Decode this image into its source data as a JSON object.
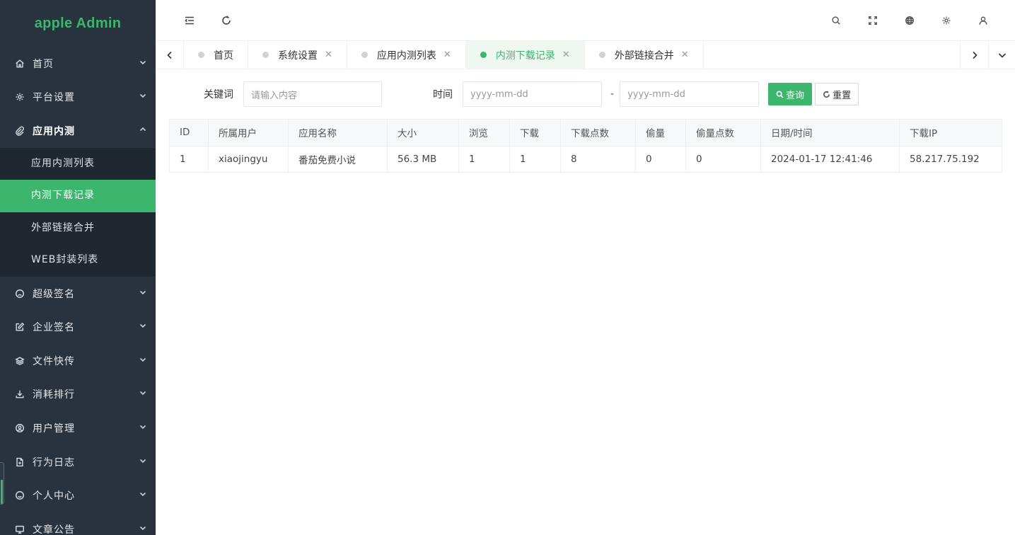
{
  "app": {
    "title": "apple Admin"
  },
  "sidebar": {
    "items": [
      {
        "label": "首页",
        "icon": "home-icon"
      },
      {
        "label": "平台设置",
        "icon": "gear-icon"
      },
      {
        "label": "应用内测",
        "icon": "paperclip-icon",
        "open": true,
        "children": [
          "应用内测列表",
          "内测下载记录",
          "外部链接合并",
          "WEB封装列表"
        ],
        "active_child": 1
      },
      {
        "label": "超级签名",
        "icon": "frown-face-icon"
      },
      {
        "label": "企业签名",
        "icon": "edit-icon"
      },
      {
        "label": "文件快传",
        "icon": "layers-icon"
      },
      {
        "label": "消耗排行",
        "icon": "download-icon"
      },
      {
        "label": "用户管理",
        "icon": "user-circle-icon"
      },
      {
        "label": "行为日志",
        "icon": "file-plus-icon"
      },
      {
        "label": "个人中心",
        "icon": "smile-face-icon"
      },
      {
        "label": "文章公告",
        "icon": "monitor-icon"
      }
    ]
  },
  "header": {
    "left_icons": [
      "menu-fold-icon",
      "refresh-icon"
    ],
    "right_icons": [
      "search-icon",
      "fullscreen-icon",
      "globe-icon",
      "gear-icon",
      "user-icon"
    ]
  },
  "tabs": [
    {
      "label": "首页",
      "closable": false
    },
    {
      "label": "系统设置",
      "closable": true
    },
    {
      "label": "应用内测列表",
      "closable": true
    },
    {
      "label": "内测下载记录",
      "closable": true,
      "active": true
    },
    {
      "label": "外部链接合并",
      "closable": true
    }
  ],
  "filters": {
    "keyword_label": "关键词",
    "keyword_placeholder": "请输入内容",
    "time_label": "时间",
    "date_start_placeholder": "yyyy-mm-dd",
    "date_separator": "-",
    "date_end_placeholder": "yyyy-mm-dd",
    "search_button": "查询",
    "reset_button": "重置"
  },
  "table": {
    "columns": [
      "ID",
      "所属用户",
      "应用名称",
      "大小",
      "浏览",
      "下载",
      "下载点数",
      "偷量",
      "偷量点数",
      "日期/时间",
      "下载IP"
    ],
    "rows": [
      [
        "1",
        "xiaojingyu",
        "番茄免费小说",
        "56.3 MB",
        "1",
        "1",
        "8",
        "0",
        "0",
        "2024-01-17 12:41:46",
        "58.217.75.192"
      ]
    ]
  },
  "colors": {
    "accent": "#3cb56d",
    "sidebar_bg": "#28333e",
    "submenu_bg": "#1f2731"
  }
}
